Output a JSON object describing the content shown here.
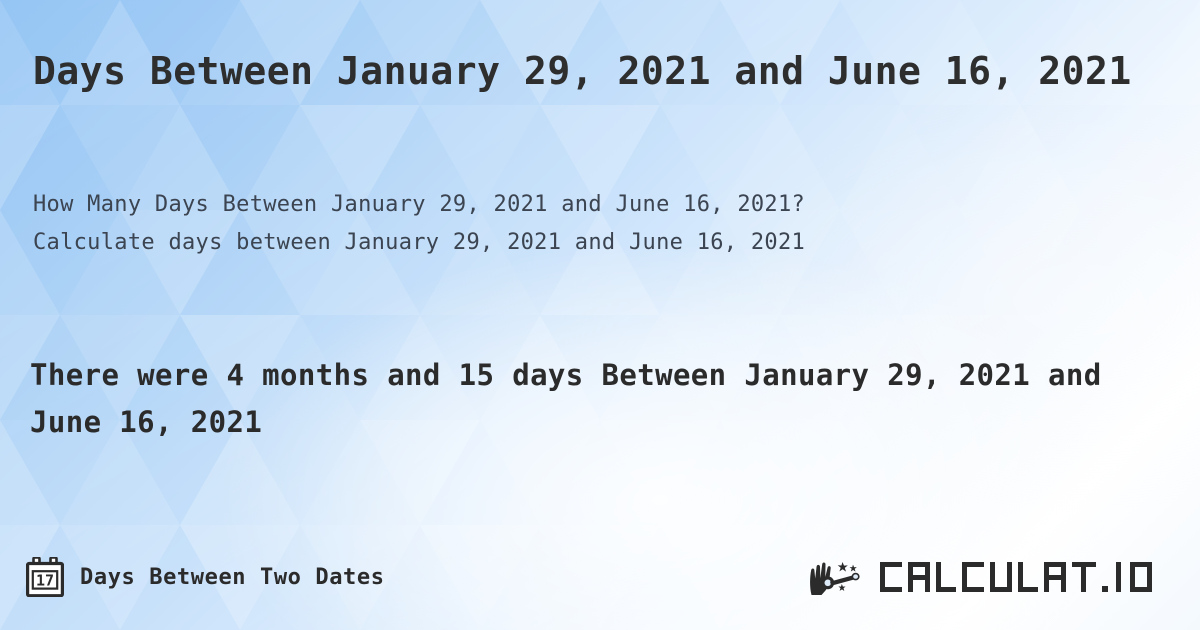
{
  "page": {
    "title_line1": "Days Between January 29, 2021 and",
    "title_line2": "June 16, 2021",
    "title_full": "Days Between January 29, 2021 and June 16, 2021"
  },
  "description": {
    "line1": "How Many Days Between January 29, 2021 and June 16, 2021?",
    "line2": "Calculate days between January 29, 2021 and June 16, 2021"
  },
  "result": {
    "text": "There were 4 months and 15 days Between January 29, 2021 and June 16, 2021",
    "months": 4,
    "days": 15,
    "start_date": "January 29, 2021",
    "end_date": "June 16, 2021"
  },
  "footer": {
    "tool_label": "Days Between Two Dates",
    "calendar_icon_day": "17",
    "calendar_icon_name": "calendar-17-icon",
    "brand_name": "CALCULAT.IO",
    "brand_icon_name": "magic-wand-hand-icon"
  },
  "colors": {
    "text_dark": "#2b2b2b",
    "text_body": "#3b4450",
    "bg_blue_dark": "#8fc2f4",
    "bg_blue_mid": "#a9d0f6",
    "bg_blue_light": "#d6e8fc",
    "bg_white": "#ffffff"
  }
}
